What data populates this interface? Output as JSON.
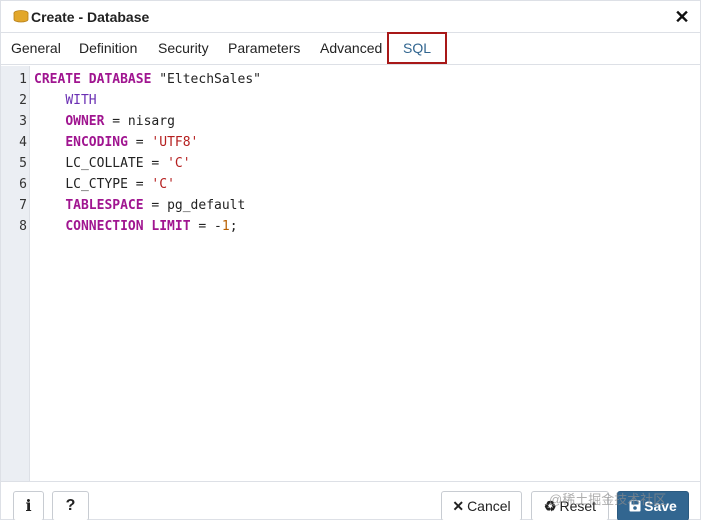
{
  "dialog": {
    "title": "Create - Database",
    "close_label": "✕"
  },
  "tabs": [
    {
      "label": "General"
    },
    {
      "label": "Definition"
    },
    {
      "label": "Security"
    },
    {
      "label": "Parameters"
    },
    {
      "label": "Advanced"
    },
    {
      "label": "SQL",
      "active": true
    }
  ],
  "editor": {
    "line_numbers": [
      "1",
      "2",
      "3",
      "4",
      "5",
      "6",
      "7",
      "8"
    ],
    "lines": [
      {
        "kw": "CREATE DATABASE",
        "rest": " \"EltechSales\""
      },
      {
        "indent": "    ",
        "kw2": "WITH"
      },
      {
        "indent": "    ",
        "kw": "OWNER",
        "rest": " = nisarg"
      },
      {
        "indent": "    ",
        "kw": "ENCODING",
        "rest": " = ",
        "str": "'UTF8'"
      },
      {
        "indent": "    ",
        "plain": "LC_COLLATE",
        "rest": " = ",
        "str": "'C'"
      },
      {
        "indent": "    ",
        "plain": "LC_CTYPE",
        "rest": " = ",
        "str": "'C'"
      },
      {
        "indent": "    ",
        "kw": "TABLESPACE",
        "rest": " = pg_default"
      },
      {
        "indent": "    ",
        "kw": "CONNECTION LIMIT",
        "rest": " = -",
        "num": "1",
        "tail": ";"
      }
    ]
  },
  "footer": {
    "info_label": "i",
    "help_label": "?",
    "cancel_icon": "✕",
    "cancel_label": "Cancel",
    "reset_icon": "♻",
    "reset_label": "Reset",
    "save_icon": "💾",
    "save_label": "Save"
  },
  "watermark": "@稀土掘金技术社区",
  "colors": {
    "accent": "#326690",
    "active_tab_outline": "#a81818",
    "keyword": "#a01590",
    "string": "#b51f1f",
    "number": "#b85f00"
  },
  "icons": {
    "title": "database-icon",
    "close": "close-icon",
    "info": "info-icon",
    "help": "help-icon",
    "cancel": "close-icon",
    "reset": "recycle-icon",
    "save": "save-icon"
  }
}
